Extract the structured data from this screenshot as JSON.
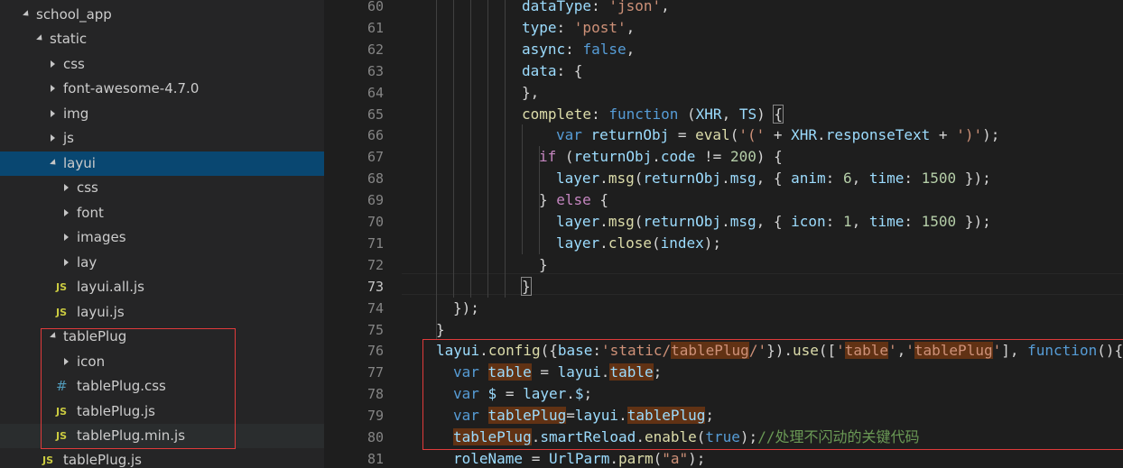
{
  "explorer": {
    "rows": [
      {
        "label": "school_app",
        "kind": "folder",
        "state": "open"
      },
      {
        "label": "static",
        "kind": "folder",
        "state": "open"
      },
      {
        "label": "css",
        "kind": "folder",
        "state": "closed"
      },
      {
        "label": "font-awesome-4.7.0",
        "kind": "folder",
        "state": "closed"
      },
      {
        "label": "img",
        "kind": "folder",
        "state": "closed"
      },
      {
        "label": "js",
        "kind": "folder",
        "state": "closed"
      },
      {
        "label": "layui",
        "kind": "folder",
        "state": "open",
        "selected": true
      },
      {
        "label": "css",
        "kind": "folder",
        "state": "closed"
      },
      {
        "label": "font",
        "kind": "folder",
        "state": "closed"
      },
      {
        "label": "images",
        "kind": "folder",
        "state": "closed"
      },
      {
        "label": "lay",
        "kind": "folder",
        "state": "closed"
      },
      {
        "label": "layui.all.js",
        "kind": "js",
        "icon": "JS"
      },
      {
        "label": "layui.js",
        "kind": "js",
        "icon": "JS"
      },
      {
        "label": "tablePlug",
        "kind": "folder",
        "state": "open"
      },
      {
        "label": "icon",
        "kind": "folder",
        "state": "closed"
      },
      {
        "label": "tablePlug.css",
        "kind": "css",
        "icon": "#"
      },
      {
        "label": "tablePlug.js",
        "kind": "js",
        "icon": "JS"
      },
      {
        "label": "tablePlug.min.js",
        "kind": "js",
        "icon": "JS",
        "hover": true
      },
      {
        "label": "tablePlug.js",
        "kind": "js",
        "icon": "JS"
      }
    ]
  },
  "editor": {
    "line_numbers": [
      "60",
      "61",
      "62",
      "63",
      "64",
      "65",
      "66",
      "67",
      "68",
      "69",
      "70",
      "71",
      "72",
      "73",
      "74",
      "75",
      "76",
      "77",
      "78",
      "79",
      "80",
      "81"
    ],
    "active_line": "73",
    "lines": [
      [
        {
          "t": "dataType",
          "c": "p"
        },
        {
          "t": ": "
        },
        {
          "t": "'json'",
          "c": "s"
        },
        {
          "t": ","
        }
      ],
      [
        {
          "t": "type",
          "c": "p"
        },
        {
          "t": ": "
        },
        {
          "t": "'post'",
          "c": "s"
        },
        {
          "t": ","
        }
      ],
      [
        {
          "t": "async",
          "c": "p"
        },
        {
          "t": ": "
        },
        {
          "t": "false",
          "c": "k"
        },
        {
          "t": ","
        }
      ],
      [
        {
          "t": "data",
          "c": "p"
        },
        {
          "t": ": {"
        }
      ],
      [
        {
          "t": "},"
        }
      ],
      [
        {
          "t": "complete",
          "c": "f"
        },
        {
          "t": ": "
        },
        {
          "t": "function",
          "c": "k"
        },
        {
          "t": " ("
        },
        {
          "t": "XHR",
          "c": "p"
        },
        {
          "t": ", "
        },
        {
          "t": "TS",
          "c": "p"
        },
        {
          "t": ") "
        },
        {
          "t": "{",
          "c": "bm"
        }
      ],
      [
        {
          "t": "var",
          "c": "k"
        },
        {
          "t": " "
        },
        {
          "t": "returnObj",
          "c": "p"
        },
        {
          "t": " = "
        },
        {
          "t": "eval",
          "c": "f"
        },
        {
          "t": "("
        },
        {
          "t": "'('",
          "c": "s"
        },
        {
          "t": " + "
        },
        {
          "t": "XHR",
          "c": "p"
        },
        {
          "t": "."
        },
        {
          "t": "responseText",
          "c": "p"
        },
        {
          "t": " + "
        },
        {
          "t": "')'",
          "c": "s"
        },
        {
          "t": ");"
        }
      ],
      [
        {
          "t": "if",
          "c": "ctl"
        },
        {
          "t": " ("
        },
        {
          "t": "returnObj",
          "c": "p"
        },
        {
          "t": "."
        },
        {
          "t": "code",
          "c": "p"
        },
        {
          "t": " != "
        },
        {
          "t": "200",
          "c": "n"
        },
        {
          "t": ") {"
        }
      ],
      [
        {
          "t": "layer",
          "c": "p"
        },
        {
          "t": "."
        },
        {
          "t": "msg",
          "c": "f"
        },
        {
          "t": "("
        },
        {
          "t": "returnObj",
          "c": "p"
        },
        {
          "t": "."
        },
        {
          "t": "msg",
          "c": "p"
        },
        {
          "t": ", { "
        },
        {
          "t": "anim",
          "c": "p"
        },
        {
          "t": ": "
        },
        {
          "t": "6",
          "c": "n"
        },
        {
          "t": ", "
        },
        {
          "t": "time",
          "c": "p"
        },
        {
          "t": ": "
        },
        {
          "t": "1500",
          "c": "n"
        },
        {
          "t": " });"
        }
      ],
      [
        {
          "t": "} "
        },
        {
          "t": "else",
          "c": "ctl"
        },
        {
          "t": " {"
        }
      ],
      [
        {
          "t": "layer",
          "c": "p"
        },
        {
          "t": "."
        },
        {
          "t": "msg",
          "c": "f"
        },
        {
          "t": "("
        },
        {
          "t": "returnObj",
          "c": "p"
        },
        {
          "t": "."
        },
        {
          "t": "msg",
          "c": "p"
        },
        {
          "t": ", { "
        },
        {
          "t": "icon",
          "c": "p"
        },
        {
          "t": ": "
        },
        {
          "t": "1",
          "c": "n"
        },
        {
          "t": ", "
        },
        {
          "t": "time",
          "c": "p"
        },
        {
          "t": ": "
        },
        {
          "t": "1500",
          "c": "n"
        },
        {
          "t": " });"
        }
      ],
      [
        {
          "t": "layer",
          "c": "p"
        },
        {
          "t": "."
        },
        {
          "t": "close",
          "c": "f"
        },
        {
          "t": "("
        },
        {
          "t": "index",
          "c": "p"
        },
        {
          "t": ");"
        }
      ],
      [
        {
          "t": "}"
        }
      ],
      [
        {
          "t": "}",
          "c": "bm"
        }
      ],
      [
        {
          "t": "});"
        }
      ],
      [
        {
          "t": "}"
        }
      ],
      [
        {
          "t": "layui",
          "c": "p"
        },
        {
          "t": "."
        },
        {
          "t": "config",
          "c": "f"
        },
        {
          "t": "({"
        },
        {
          "t": "base",
          "c": "p"
        },
        {
          "t": ":"
        },
        {
          "t": "'static/",
          "c": "s"
        },
        {
          "t": "tablePlug",
          "c": "s hl"
        },
        {
          "t": "/'",
          "c": "s"
        },
        {
          "t": "})."
        },
        {
          "t": "use",
          "c": "f"
        },
        {
          "t": "(["
        },
        {
          "t": "'",
          "c": "s"
        },
        {
          "t": "table",
          "c": "s hl"
        },
        {
          "t": "'",
          "c": "s"
        },
        {
          "t": ","
        },
        {
          "t": "'",
          "c": "s"
        },
        {
          "t": "tablePlug",
          "c": "s hl"
        },
        {
          "t": "'",
          "c": "s"
        },
        {
          "t": "], "
        },
        {
          "t": "function",
          "c": "k"
        },
        {
          "t": "(){"
        }
      ],
      [
        {
          "t": "var",
          "c": "k"
        },
        {
          "t": " "
        },
        {
          "t": "table",
          "c": "p hl"
        },
        {
          "t": " = "
        },
        {
          "t": "layui",
          "c": "p"
        },
        {
          "t": "."
        },
        {
          "t": "table",
          "c": "p hl"
        },
        {
          "t": ";"
        }
      ],
      [
        {
          "t": "var",
          "c": "k"
        },
        {
          "t": " "
        },
        {
          "t": "$",
          "c": "p"
        },
        {
          "t": " = "
        },
        {
          "t": "layer",
          "c": "p"
        },
        {
          "t": "."
        },
        {
          "t": "$",
          "c": "p"
        },
        {
          "t": ";"
        }
      ],
      [
        {
          "t": "var",
          "c": "k"
        },
        {
          "t": " "
        },
        {
          "t": "tablePlug",
          "c": "p hl"
        },
        {
          "t": "="
        },
        {
          "t": "layui",
          "c": "p"
        },
        {
          "t": "."
        },
        {
          "t": "tablePlug",
          "c": "p hl"
        },
        {
          "t": ";"
        }
      ],
      [
        {
          "t": "tablePlug",
          "c": "p hl"
        },
        {
          "t": "."
        },
        {
          "t": "smartReload",
          "c": "p"
        },
        {
          "t": "."
        },
        {
          "t": "enable",
          "c": "f"
        },
        {
          "t": "("
        },
        {
          "t": "true",
          "c": "k"
        },
        {
          "t": ");"
        },
        {
          "t": "//处理不闪动的关键代码",
          "c": "c"
        }
      ],
      [
        {
          "t": "roleName",
          "c": "p"
        },
        {
          "t": " = "
        },
        {
          "t": "UrlParm",
          "c": "p"
        },
        {
          "t": "."
        },
        {
          "t": "parm",
          "c": "f"
        },
        {
          "t": "("
        },
        {
          "t": "\"a\"",
          "c": "s"
        },
        {
          "t": ");"
        }
      ]
    ]
  }
}
